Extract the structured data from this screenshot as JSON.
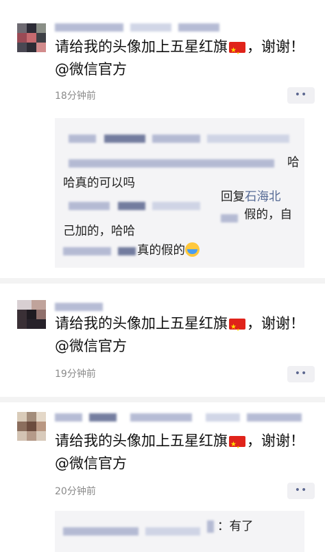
{
  "comments": [
    {
      "text": "请给我的头像加上五星红旗",
      "text_after_flag": "，谢谢！@微信官方",
      "time": "18分钟前",
      "more_icon": "••"
    },
    {
      "text": "请给我的头像加上五星红旗",
      "text_after_flag": "，谢谢！@微信官方",
      "time": "19分钟前",
      "more_icon": "••"
    },
    {
      "text": "请给我的头像加上五星红旗",
      "text_after_flag": "，谢谢！@微信官方",
      "time": "20分钟前",
      "more_icon": "••"
    }
  ],
  "replies1": {
    "r1_tail": "哈",
    "r1_line2": "哈真的可以吗",
    "r2_reply_word": "回复",
    "r2_name": "石海北",
    "r2_tail": "假的，自",
    "r2_line2": "己加的，哈哈",
    "r3_text": "真的假的"
  },
  "replies3": {
    "r1_tail": "：有了"
  }
}
